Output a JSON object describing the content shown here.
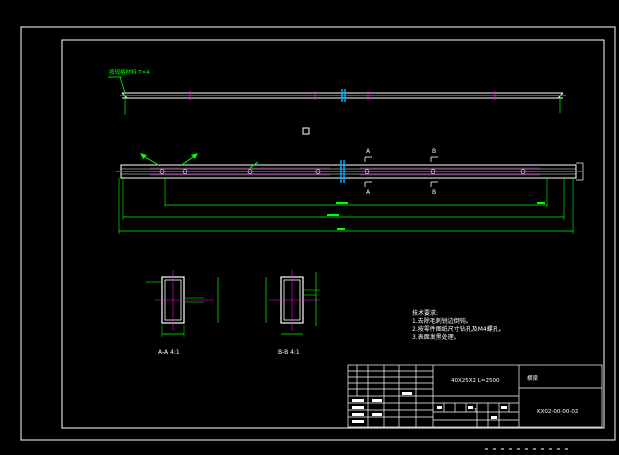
{
  "drawing": {
    "leader_label": "按规格材料 T=4",
    "section_aa_letter": "A",
    "section_bb_letter": "B",
    "section_aa_caption": "A-A 4:1",
    "section_bb_caption": "B-B 4:1"
  },
  "notes": {
    "title": "技术要求:",
    "items": [
      "1.去除毛刺锐边倒钝。",
      "2.按零件图纸尺寸钻孔及M4螺孔。",
      "3.表面发黑处理。"
    ]
  },
  "title_block": {
    "spec": "40X25X2  L=2500",
    "name": "横梁",
    "drawing_no": "KX02-00-00-02",
    "sheet": "1"
  },
  "colors": {
    "background": "#000000",
    "border": "#ffffff",
    "outline": "#ffffff",
    "dimension": "#00ff00",
    "centerline": "#ff00ff",
    "marker": "#ff00ff"
  }
}
